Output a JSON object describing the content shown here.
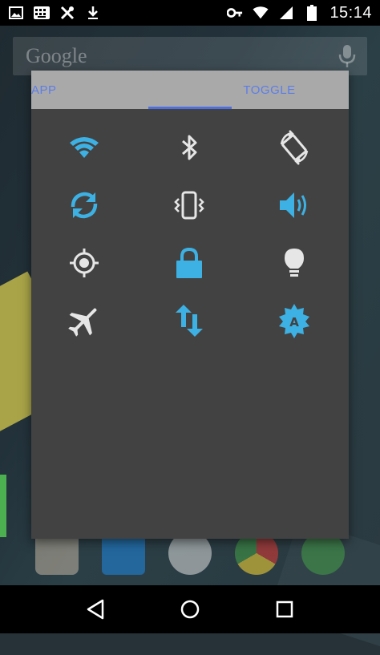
{
  "colors": {
    "accent_blue": "#3db1e3",
    "icon_white": "#e6e6e6",
    "tab_text": "#5d7ee8",
    "panel_bg": "#424242",
    "tab_bg": "#a9a9a9"
  },
  "status_bar": {
    "time": "15:14",
    "left_icons": [
      "image-icon",
      "keyboard-icon",
      "tools-icon",
      "download-icon"
    ],
    "right_icons": [
      "vpn-key-icon",
      "wifi-icon",
      "signal-icon",
      "battery-icon"
    ]
  },
  "search": {
    "logo_text": "Google"
  },
  "tabs": [
    {
      "label": "APP",
      "selected": false
    },
    {
      "label": "TOGGLE",
      "selected": true
    }
  ],
  "toggles": [
    {
      "name": "wifi",
      "icon": "wifi-icon",
      "active": true
    },
    {
      "name": "bluetooth",
      "icon": "bluetooth-icon",
      "active": false
    },
    {
      "name": "auto-rotate",
      "icon": "rotate-icon",
      "active": false
    },
    {
      "name": "sync",
      "icon": "sync-icon",
      "active": true
    },
    {
      "name": "vibrate",
      "icon": "vibrate-icon",
      "active": false
    },
    {
      "name": "sound",
      "icon": "volume-icon",
      "active": true
    },
    {
      "name": "gps",
      "icon": "gps-icon",
      "active": false
    },
    {
      "name": "screen-lock",
      "icon": "lock-icon",
      "active": true
    },
    {
      "name": "flashlight",
      "icon": "lightbulb-icon",
      "active": false
    },
    {
      "name": "airplane-mode",
      "icon": "airplane-icon",
      "active": false
    },
    {
      "name": "mobile-data",
      "icon": "data-arrows-icon",
      "active": true
    },
    {
      "name": "auto-brightness",
      "icon": "brightness-auto-icon",
      "active": true
    }
  ],
  "navigation": {
    "buttons": [
      "back-icon",
      "home-icon",
      "recents-icon"
    ]
  }
}
